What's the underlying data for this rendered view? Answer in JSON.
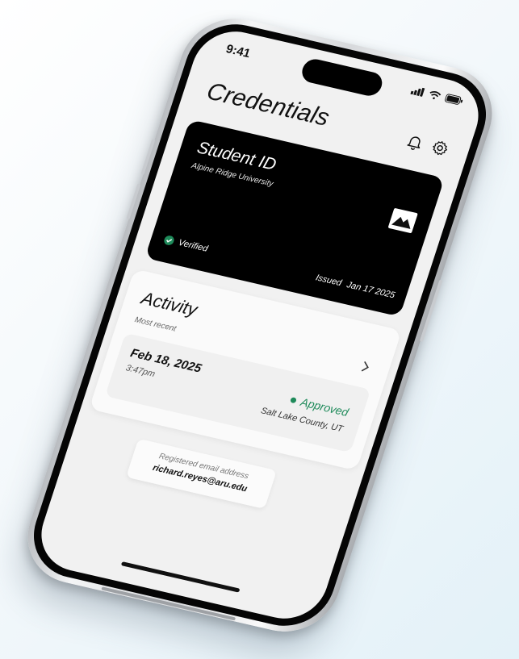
{
  "status_bar": {
    "time": "9:41"
  },
  "header": {
    "title": "Credentials",
    "icons": [
      "bell-icon",
      "gear-icon"
    ]
  },
  "credential_card": {
    "title": "Student ID",
    "issuer": "Alpine Ridge University",
    "status": "Verified",
    "issued_label": "Issued",
    "issued_date": "Jan 17 2025",
    "colors": {
      "background": "#000000",
      "verified": "#1e8a5a"
    }
  },
  "activity": {
    "title": "Activity",
    "subtitle": "Most recent",
    "entry": {
      "date": "Feb 18, 2025",
      "time": "3:47pm",
      "status": "Approved",
      "location": "Salt Lake County, UT"
    }
  },
  "email": {
    "label": "Registered email address",
    "value": "richard.reyes@aru.edu"
  },
  "colors": {
    "approved": "#1e8a5a"
  }
}
